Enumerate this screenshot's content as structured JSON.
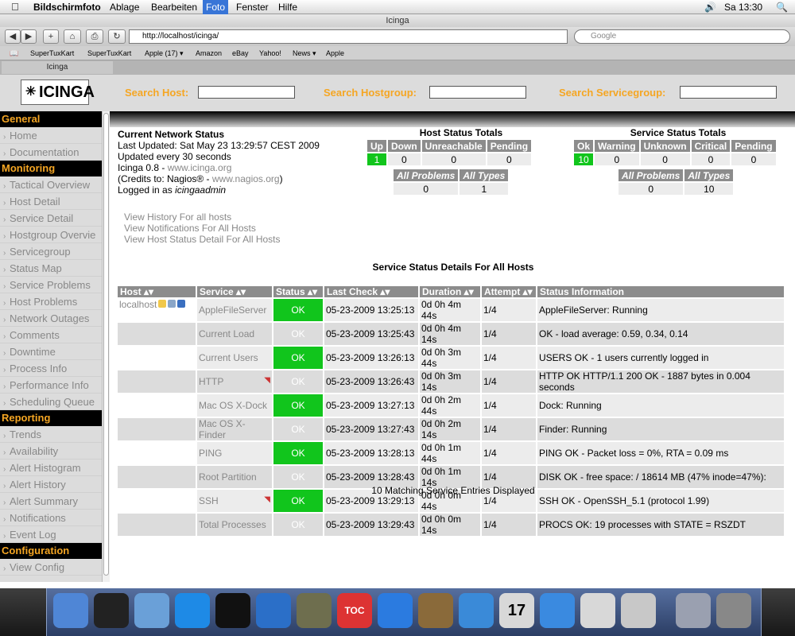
{
  "menubar": {
    "apple": "",
    "app": "Bildschirmfoto",
    "items": [
      "Ablage",
      "Bearbeiten",
      "Foto",
      "Fenster",
      "Hilfe"
    ],
    "clock": "Sa 13:30"
  },
  "browser": {
    "title": "Icinga",
    "url": "http://localhost/icinga/",
    "search_placeholder": "Google",
    "bookmarks": [
      "SuperTuxKart",
      "SuperTuxKart",
      "Apple (17) ▾",
      "Amazon",
      "eBay",
      "Yahoo!",
      "News ▾",
      "Apple"
    ],
    "tab": "Icinga"
  },
  "header": {
    "logo": "ICINGA",
    "search_host": "Search Host:",
    "search_hostgroup": "Search Hostgroup:",
    "search_servicegroup": "Search Servicegroup:"
  },
  "sidebar": {
    "sections": [
      {
        "title": "General",
        "items": [
          "Home",
          "Documentation"
        ]
      },
      {
        "title": "Monitoring",
        "items": [
          "Tactical Overview",
          "Host Detail",
          "Service Detail",
          "Hostgroup Overvie",
          "Servicegroup",
          "Status Map",
          "Service Problems",
          "Host Problems",
          "Network Outages",
          "Comments",
          "Downtime",
          "Process Info",
          "Performance Info",
          "Scheduling Queue"
        ]
      },
      {
        "title": "Reporting",
        "items": [
          "Trends",
          "Availability",
          "Alert Histogram",
          "Alert History",
          "Alert Summary",
          "Notifications",
          "Event Log"
        ]
      },
      {
        "title": "Configuration",
        "items": [
          "View Config"
        ]
      }
    ]
  },
  "status": {
    "title": "Current Network Status",
    "last_updated": "Last Updated: Sat May 23 13:29:57 CEST 2009",
    "updated_every": "Updated every 30 seconds",
    "version": "Icinga 0.8 - ",
    "version_link": "www.icinga.org",
    "credits": "(Credits to: Nagios® - ",
    "credits_link": "www.nagios.org",
    "credits_end": ")",
    "logged_in": "Logged in as ",
    "user": "icingaadmin",
    "links": [
      "View History For all hosts",
      "View Notifications For All Hosts",
      "View Host Status Detail For All Hosts"
    ]
  },
  "host_totals": {
    "title": "Host Status Totals",
    "headers": [
      "Up",
      "Down",
      "Unreachable",
      "Pending"
    ],
    "values": [
      "1",
      "0",
      "0",
      "0"
    ],
    "all_headers": [
      "All Problems",
      "All Types"
    ],
    "all_values": [
      "0",
      "1"
    ]
  },
  "service_totals": {
    "title": "Service Status Totals",
    "headers": [
      "Ok",
      "Warning",
      "Unknown",
      "Critical",
      "Pending"
    ],
    "values": [
      "10",
      "0",
      "0",
      "0",
      "0"
    ],
    "all_headers": [
      "All Problems",
      "All Types"
    ],
    "all_values": [
      "0",
      "10"
    ]
  },
  "services": {
    "title": "Service Status Details For All Hosts",
    "columns": [
      "Host ▴▾",
      "Service ▴▾",
      "Status ▴▾",
      "Last Check ▴▾",
      "Duration ▴▾",
      "Attempt ▴▾",
      "Status Information"
    ],
    "host": "localhost",
    "rows": [
      {
        "service": "AppleFileServer",
        "status": "OK",
        "last_check": "05-23-2009 13:25:13",
        "duration": "0d 0h 4m 44s",
        "attempt": "1/4",
        "info": "AppleFileServer: Running"
      },
      {
        "service": "Current Load",
        "status": "OK",
        "last_check": "05-23-2009 13:25:43",
        "duration": "0d 0h 4m 14s",
        "attempt": "1/4",
        "info": "OK - load average: 0.59, 0.34, 0.14"
      },
      {
        "service": "Current Users",
        "status": "OK",
        "last_check": "05-23-2009 13:26:13",
        "duration": "0d 0h 3m 44s",
        "attempt": "1/4",
        "info": "USERS OK - 1 users currently logged in"
      },
      {
        "service": "HTTP",
        "status": "OK",
        "last_check": "05-23-2009 13:26:43",
        "duration": "0d 0h 3m 14s",
        "attempt": "1/4",
        "info": "HTTP OK HTTP/1.1 200 OK - 1887 bytes in 0.004 seconds"
      },
      {
        "service": "Mac OS X-Dock",
        "status": "OK",
        "last_check": "05-23-2009 13:27:13",
        "duration": "0d 0h 2m 44s",
        "attempt": "1/4",
        "info": "Dock: Running"
      },
      {
        "service": "Mac OS X-Finder",
        "status": "OK",
        "last_check": "05-23-2009 13:27:43",
        "duration": "0d 0h 2m 14s",
        "attempt": "1/4",
        "info": "Finder: Running"
      },
      {
        "service": "PING",
        "status": "OK",
        "last_check": "05-23-2009 13:28:13",
        "duration": "0d 0h 1m 44s",
        "attempt": "1/4",
        "info": "PING OK - Packet loss = 0%, RTA = 0.09 ms"
      },
      {
        "service": "Root Partition",
        "status": "OK",
        "last_check": "05-23-2009 13:28:43",
        "duration": "0d 0h 1m 14s",
        "attempt": "1/4",
        "info": "DISK OK - free space: / 18614 MB (47% inode=47%):"
      },
      {
        "service": "SSH",
        "status": "OK",
        "last_check": "05-23-2009 13:29:13",
        "duration": "0d 0h 0m 44s",
        "attempt": "1/4",
        "info": "SSH OK - OpenSSH_5.1 (protocol 1.99)"
      },
      {
        "service": "Total Processes",
        "status": "OK",
        "last_check": "05-23-2009 13:29:43",
        "duration": "0d 0h 0m 14s",
        "attempt": "1/4",
        "info": "PROCS OK: 19 processes with STATE = RSZDT"
      }
    ],
    "matching": "10 Matching Service Entries Displayed"
  },
  "colors": {
    "ok": "#11c51c",
    "accent": "#f5a623",
    "header": "#8c8c8c"
  },
  "dock": [
    "finder-icon",
    "dashboard-icon",
    "mail-icon",
    "safari-icon",
    "terminal-icon",
    "thunderbird-icon",
    "gimp-icon",
    "toc-icon",
    "ichat-icon",
    "addressbook-icon",
    "itunes-icon",
    "ical-icon",
    "quicktime-icon",
    "preview-icon",
    "screenshot-icon",
    "system-icon",
    "trash-icon"
  ],
  "dock_labels": {
    "ical": "17",
    "toc": "TOC"
  }
}
